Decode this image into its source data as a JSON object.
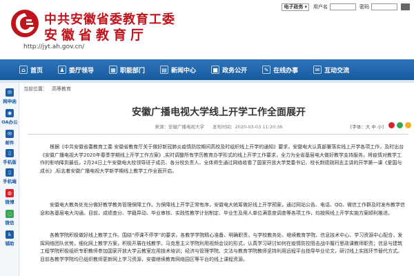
{
  "header": {
    "line1": "中共安徽省委教育工委",
    "line2": "安徽省教育厅",
    "url": "http://jyt.ah.gov.cn/",
    "brand_color": "#c0141c"
  },
  "login": {
    "select_label": "电子政务",
    "username_label": "用户名",
    "password_label": "密码"
  },
  "nav": {
    "background": "#1e64ab",
    "items": [
      {
        "label": "首页",
        "icon": "home-icon",
        "glyph": "⌂"
      },
      {
        "label": "委厅领导",
        "icon": "leader-icon",
        "glyph": "♟"
      },
      {
        "label": "职能部门",
        "icon": "department-icon",
        "glyph": "▦"
      },
      {
        "label": "新闻中心",
        "icon": "news-icon",
        "glyph": "▤"
      },
      {
        "label": "政务公开",
        "icon": "gov-open-icon",
        "glyph": "■"
      },
      {
        "label": "在线办事",
        "icon": "online-service-icon",
        "glyph": "✎"
      },
      {
        "label": "互动交流",
        "icon": "interaction-icon",
        "glyph": "✉"
      }
    ]
  },
  "sidebar": {
    "items": [
      {
        "label": "网申函",
        "icon": "letter-icon",
        "color": "#1b5ca5",
        "glyph": "✉"
      },
      {
        "label": "OA办公",
        "icon": "oa-icon",
        "color": "#1b5ca5",
        "glyph": "◉"
      },
      {
        "label": "邮件",
        "icon": "mail-icon",
        "color": "#1b5ca5",
        "glyph": "✉"
      },
      {
        "label": "手机版",
        "icon": "mobile-icon",
        "color": "#1b5ca5",
        "glyph": "▯"
      },
      {
        "label": "手机端",
        "icon": "mobile-app-icon",
        "color": "#1b5ca5",
        "glyph": "▯"
      },
      {
        "label": "微博",
        "icon": "weibo-icon",
        "color": "#d8232a",
        "glyph": "◍"
      },
      {
        "label": "微信",
        "icon": "wechat-icon",
        "color": "#3aa655",
        "glyph": "◌"
      },
      {
        "label": "辅助",
        "icon": "accessibility-icon",
        "color": "#1b5ca5",
        "glyph": "♿"
      }
    ]
  },
  "breadcrumb": {
    "prefix": "当前位置：",
    "section": "高等教育"
  },
  "article": {
    "title": "安徽广播电视大学线上开学工作全面展开",
    "source": "来源：安徽广播电视大学",
    "date": "发布时间：2020-03-03 11:20:36",
    "font_size": "[字体：大 中 小]",
    "paragraphs": [
      "根据《中共安徽省委教育工委 安徽省教育厅关于做好新冠肺炎疫情防控期间高校及时组织线上开学的通知》要求，安徽电大认真部署落实线上开学各项工作，及时出台《安徽广播电视大学2020年春季学期线上开学工作方案》,实时调整所有学历教育办学形式的线上开学工作要求，全力为全省基层电大做好教学支持服务，将疫情对教学工作的影响降到最低，2月24日上午安徽电大校领导班子成员、各分校负责人、全体师生通过网络收看了国家开放大学党委书记、校长荆德刚同志主讲的开学第一课《爱国与成长》,标志着安徽广播电视大学新学期线上教学工作全面开启。",
      "安徽电大教务处充分做好教学教务管理保障工作。为保障线上开学正常有序，安徽电大统筹做好线上开学预案，通过网站公告、电话、QQ、微信工作群及时发布教学信息和各基层电大沟通。目前，成绩查分、学籍异动、毕业审核、实践性教学计划制定、毕业生及用人单位满意度调查等各项工作，均按照线上开学实施方案顺利推进。",
      "各教学院积极做好线上教学工作。围绕“停课不停学”的要求，各教学学院精心准备、明确职责，与学校教务处、继续教育学院、信息技术中心、学习资源中心配合，发挥网络团队优势，细化网上教学方案，积极开展在线教学。马克思主义学院利用视频会议的形式，认真学习研讨如何在疫情防控阻击战中履行思政课教师职责；信息与建筑工程学院积极组织专职教师参加国家开放大学云教室应用技术培训；经济与管理学院、文法与教育学院教师坚持利用远程平台指导毕业论文，研讨线上实践环节替代方式。目前各教学学院均已组织教师更新网上学习资源，安徽继续教育网络园区等平台的线上课程资源。"
    ]
  }
}
